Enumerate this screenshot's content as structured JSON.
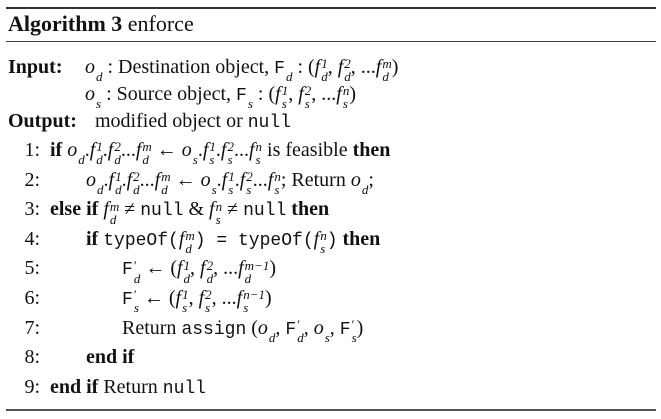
{
  "algorithm": {
    "title_bold": "Algorithm 3",
    "title_name": "enforce",
    "input_label": "Input:",
    "output_label": "Output:",
    "inputs": [
      {
        "tokens": [
          [
            "m",
            "o",
            "d",
            ""
          ],
          [
            "t",
            " : Destination object, ",
            "",
            ""
          ],
          [
            "F",
            "F",
            "d",
            ""
          ],
          [
            "t",
            " : (",
            "",
            ""
          ],
          [
            "m",
            "f",
            "d",
            "1"
          ],
          [
            "t",
            ", ",
            "",
            ""
          ],
          [
            "m",
            "f",
            "d",
            "2"
          ],
          [
            "t",
            ", ...",
            "",
            ""
          ],
          [
            "m",
            "f",
            "d",
            "m"
          ],
          [
            "t",
            ")",
            "",
            ""
          ]
        ]
      },
      {
        "tokens": [
          [
            "m",
            "o",
            "s",
            ""
          ],
          [
            "t",
            " : Source object, ",
            "",
            ""
          ],
          [
            "F",
            "F",
            "s",
            ""
          ],
          [
            "t",
            " : (",
            "",
            ""
          ],
          [
            "m",
            "f",
            "s",
            "1"
          ],
          [
            "t",
            ", ",
            "",
            ""
          ],
          [
            "m",
            "f",
            "s",
            "2"
          ],
          [
            "t",
            ", ...",
            "",
            ""
          ],
          [
            "m",
            "f",
            "s",
            "n"
          ],
          [
            "t",
            ")",
            "",
            ""
          ]
        ]
      }
    ],
    "output": {
      "tokens": [
        [
          "t",
          "modified object or ",
          "",
          ""
        ],
        [
          "c",
          "null",
          "",
          ""
        ]
      ]
    },
    "lines": [
      {
        "num": "1:",
        "indent": 0,
        "tokens": [
          [
            "b",
            "if",
            "",
            ""
          ],
          [
            "t",
            " ",
            "",
            ""
          ],
          [
            "m",
            "o",
            "d",
            ""
          ],
          [
            "t",
            ".",
            "",
            ""
          ],
          [
            "m",
            "f",
            "d",
            "1"
          ],
          [
            "t",
            ".",
            "",
            ""
          ],
          [
            "m",
            "f",
            "d",
            "2"
          ],
          [
            "t",
            "...",
            "",
            ""
          ],
          [
            "m",
            "f",
            "d",
            "m"
          ],
          [
            "t",
            " ← ",
            "",
            ""
          ],
          [
            "m",
            "o",
            "s",
            ""
          ],
          [
            "t",
            ".",
            "",
            ""
          ],
          [
            "m",
            "f",
            "s",
            "1"
          ],
          [
            "t",
            ".",
            "",
            ""
          ],
          [
            "m",
            "f",
            "s",
            "2"
          ],
          [
            "t",
            "...",
            "",
            ""
          ],
          [
            "m",
            "f",
            "s",
            "n"
          ],
          [
            "t",
            " is feasible ",
            "",
            ""
          ],
          [
            "b",
            "then",
            "",
            ""
          ]
        ]
      },
      {
        "num": "2:",
        "indent": 1,
        "tokens": [
          [
            "m",
            "o",
            "d",
            ""
          ],
          [
            "t",
            ".",
            "",
            ""
          ],
          [
            "m",
            "f",
            "d",
            "1"
          ],
          [
            "t",
            ".",
            "",
            ""
          ],
          [
            "m",
            "f",
            "d",
            "2"
          ],
          [
            "t",
            "...",
            "",
            ""
          ],
          [
            "m",
            "f",
            "d",
            "m"
          ],
          [
            "t",
            " ← ",
            "",
            ""
          ],
          [
            "m",
            "o",
            "s",
            ""
          ],
          [
            "t",
            ".",
            "",
            ""
          ],
          [
            "m",
            "f",
            "s",
            "1"
          ],
          [
            "t",
            ".",
            "",
            ""
          ],
          [
            "m",
            "f",
            "s",
            "2"
          ],
          [
            "t",
            "...",
            "",
            ""
          ],
          [
            "m",
            "f",
            "s",
            "n"
          ],
          [
            "t",
            "; Return ",
            "",
            ""
          ],
          [
            "m",
            "o",
            "d",
            ""
          ],
          [
            "t",
            ";",
            "",
            ""
          ]
        ]
      },
      {
        "num": "3:",
        "indent": 0,
        "tokens": [
          [
            "b",
            "else if",
            "",
            ""
          ],
          [
            "t",
            " ",
            "",
            ""
          ],
          [
            "m",
            "f",
            "d",
            "m"
          ],
          [
            "t",
            " ≠ ",
            "",
            ""
          ],
          [
            "c",
            "null",
            "",
            ""
          ],
          [
            "t",
            " & ",
            "",
            ""
          ],
          [
            "m",
            "f",
            "s",
            "n"
          ],
          [
            "t",
            " ≠ ",
            "",
            ""
          ],
          [
            "c",
            "null",
            "",
            ""
          ],
          [
            "t",
            " ",
            "",
            ""
          ],
          [
            "b",
            "then",
            "",
            ""
          ]
        ]
      },
      {
        "num": "4:",
        "indent": 1,
        "tokens": [
          [
            "b",
            "if",
            "",
            ""
          ],
          [
            "t",
            " ",
            "",
            ""
          ],
          [
            "c",
            "typeOf(",
            "",
            ""
          ],
          [
            "m",
            "f",
            "d",
            "m"
          ],
          [
            "c",
            ") = typeOf(",
            "",
            ""
          ],
          [
            "m",
            "f",
            "s",
            "n"
          ],
          [
            "c",
            ")",
            "",
            ""
          ],
          [
            "t",
            " ",
            "",
            ""
          ],
          [
            "b",
            "then",
            "",
            ""
          ]
        ]
      },
      {
        "num": "5:",
        "indent": 2,
        "tokens": [
          [
            "F",
            "F",
            "d",
            "′"
          ],
          [
            "t",
            " ← (",
            "",
            ""
          ],
          [
            "m",
            "f",
            "d",
            "1"
          ],
          [
            "t",
            ", ",
            "",
            ""
          ],
          [
            "m",
            "f",
            "d",
            "2"
          ],
          [
            "t",
            ", ...",
            "",
            ""
          ],
          [
            "m",
            "f",
            "d",
            "m−1"
          ],
          [
            "t",
            ")",
            "",
            ""
          ]
        ]
      },
      {
        "num": "6:",
        "indent": 2,
        "tokens": [
          [
            "F",
            "F",
            "s",
            "′"
          ],
          [
            "t",
            " ← (",
            "",
            ""
          ],
          [
            "m",
            "f",
            "s",
            "1"
          ],
          [
            "t",
            ", ",
            "",
            ""
          ],
          [
            "m",
            "f",
            "s",
            "2"
          ],
          [
            "t",
            ", ...",
            "",
            ""
          ],
          [
            "m",
            "f",
            "s",
            "n−1"
          ],
          [
            "t",
            ")",
            "",
            ""
          ]
        ]
      },
      {
        "num": "7:",
        "indent": 2,
        "tokens": [
          [
            "t",
            "Return ",
            "",
            ""
          ],
          [
            "c",
            "assign",
            "",
            ""
          ],
          [
            "t",
            " (",
            "",
            ""
          ],
          [
            "m",
            "o",
            "d",
            ""
          ],
          [
            "t",
            ", ",
            "",
            ""
          ],
          [
            "F",
            "F",
            "d",
            "′"
          ],
          [
            "t",
            ", ",
            "",
            ""
          ],
          [
            "m",
            "o",
            "s",
            ""
          ],
          [
            "t",
            ", ",
            "",
            ""
          ],
          [
            "F",
            "F",
            "s",
            "′"
          ],
          [
            "t",
            ")",
            "",
            ""
          ]
        ]
      },
      {
        "num": "8:",
        "indent": 1,
        "tokens": [
          [
            "b",
            "end if",
            "",
            ""
          ]
        ]
      },
      {
        "num": "9:",
        "indent": 0,
        "tokens": [
          [
            "b",
            "end if",
            "",
            ""
          ],
          [
            "t",
            " Return ",
            "",
            ""
          ],
          [
            "c",
            "null",
            "",
            ""
          ]
        ]
      }
    ]
  }
}
